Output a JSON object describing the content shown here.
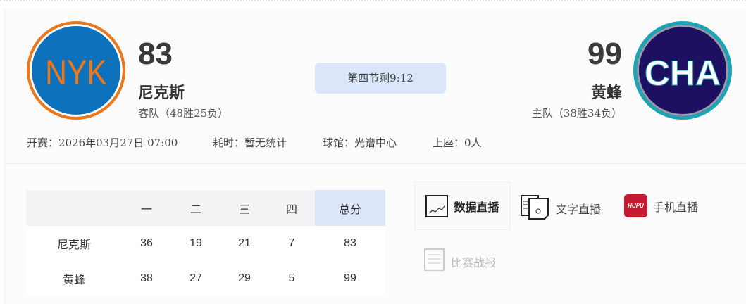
{
  "away": {
    "abbr": "NYK",
    "score": "83",
    "name": "尼克斯",
    "record": "客队（48胜25负）"
  },
  "home": {
    "abbr": "CHA",
    "score": "99",
    "name": "黄蜂",
    "record": "主队（38胜34负）"
  },
  "status": "第四节剩9:12",
  "meta": {
    "start": "开赛：2026年03月27日 07:00",
    "duration": "耗时：暂无统计",
    "venue": "球馆：光谱中心",
    "attendance": "上座：0人"
  },
  "table": {
    "headers": [
      "",
      "一",
      "二",
      "三",
      "四",
      "总分"
    ],
    "rows": [
      [
        "尼克斯",
        "36",
        "19",
        "21",
        "7",
        "83"
      ],
      [
        "黄蜂",
        "38",
        "27",
        "29",
        "5",
        "99"
      ]
    ]
  },
  "links": {
    "data": "数据直播",
    "text": "文字直播",
    "mobile": "手机直播",
    "report": "比赛战报",
    "hupu_logo": "HUPU"
  },
  "colors": {
    "accent": "#dbe6fb",
    "nyk_blue": "#0d72bb",
    "nyk_orange": "#ef7718",
    "cha_navy": "#1d1060",
    "cha_teal": "#1ba3b6",
    "hupu_red": "#c41b30"
  }
}
